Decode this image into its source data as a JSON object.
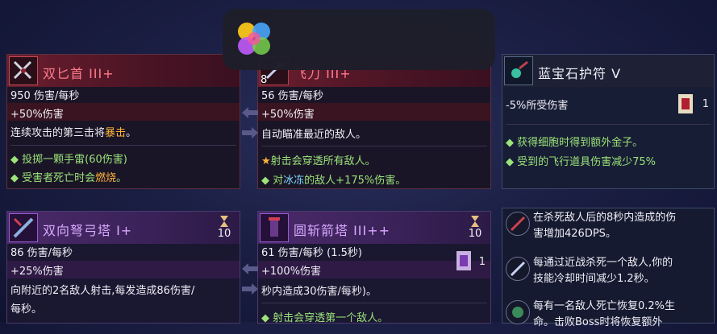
{
  "dagger": {
    "name": "双匕首 III+",
    "stat1": "950 伤害/每秒",
    "stat2": "+50%伤害",
    "desc_a": "连续攻击的第三击将",
    "desc_hl": "暴击",
    "desc_b": "。",
    "bullet1": "投掷一颗手雷(60伤害)",
    "bullet2_a": "受害者死亡时会",
    "bullet2_hl": "燃烧",
    "bullet2_b": "。"
  },
  "knives": {
    "count": "8",
    "name": "飞刀 III+",
    "stat1": "56 伤害/每秒",
    "stat2": "+50%伤害",
    "desc": "自动瞄准最近的敌人。",
    "bullet1": "射击会穿透所有敌人。",
    "bullet2_a": "对",
    "bullet2_hl": "冰冻",
    "bullet2_b": "的敌人+175%伤害。"
  },
  "amulet": {
    "name": "蓝宝石护符 V",
    "stat1": "-5%所受伤害",
    "scroll_count": "1",
    "bullet1": "获得细胞时得到额外金子。",
    "bullet2": "受到的飞行道具伤害减少75%"
  },
  "crossbow": {
    "name": "双向弩弓塔 I+",
    "timer": "10",
    "stat1": "86 伤害/每秒",
    "stat2": "+25%伤害",
    "desc1": "向附近的2名敌人射击,每发造成86伤害/",
    "desc2": "每秒。"
  },
  "arrow_tower": {
    "name": "圆斩箭塔 III++",
    "timer": "10",
    "stat1": "61 伤害/每秒 (1.5秒)",
    "stat2": "+100%伤害",
    "scroll_count": "1",
    "desc": "秒内造成30伤害/每秒)。",
    "bullet1": "射击会穿透第一个敌人。"
  },
  "mutations": [
    {
      "line1": "在杀死敌人后的8秒内造成的伤",
      "line2": "害增加426DPS。"
    },
    {
      "line1": "每通过近战杀死一个敌人,你的",
      "line2": "技能冷却时间减少1.2秒。"
    },
    {
      "line1": "每有一名敌人死亡恢复0.2%生",
      "line2": "命。击败Boss时将恢复额外"
    }
  ],
  "colors": {
    "title_red": "#ff7a8a",
    "title_purple": "#d9a8ff",
    "crit_orange": "#ffb43a",
    "freeze_cyan": "#7ad6ff",
    "bullet_green": "#9be37a"
  }
}
